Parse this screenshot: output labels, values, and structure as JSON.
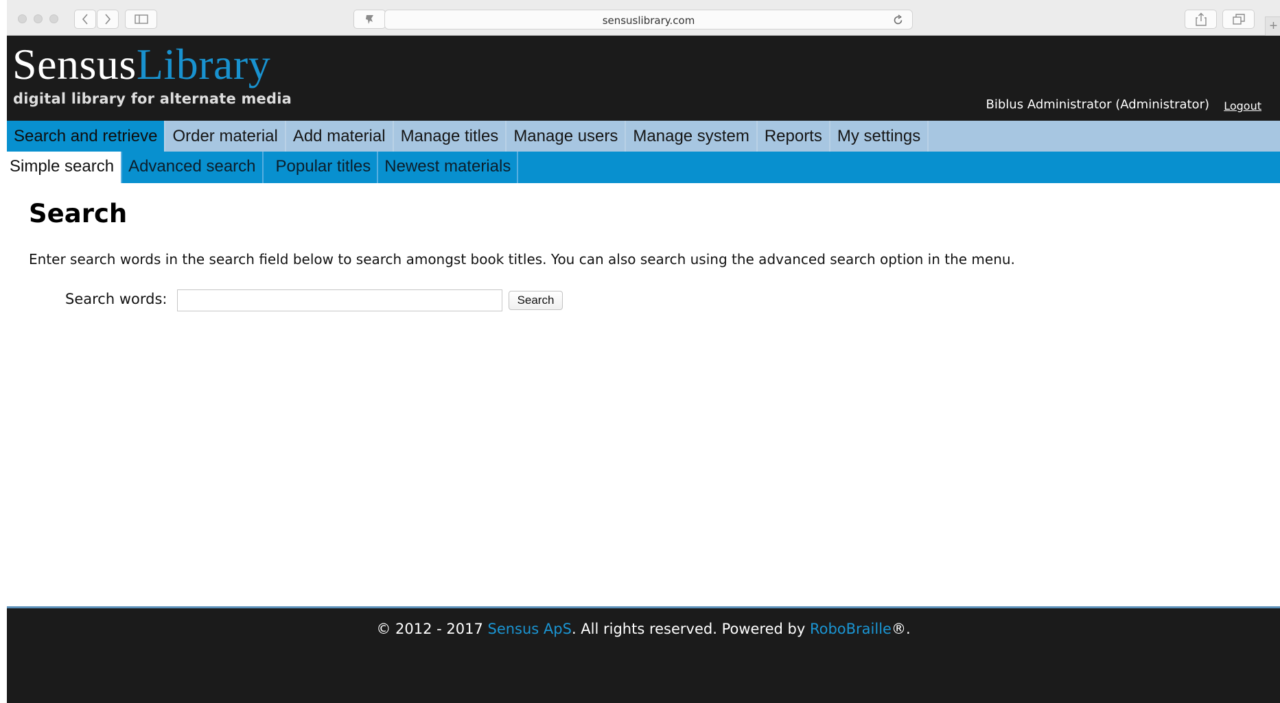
{
  "browser": {
    "url": "sensuslibrary.com"
  },
  "header": {
    "logo_part1": "Sensus",
    "logo_part2": "Library",
    "tagline": "digital library for alternate media",
    "user": "Biblus Administrator (Administrator)",
    "logout": "Logout"
  },
  "main_nav": [
    {
      "label": "Search and retrieve",
      "active": true
    },
    {
      "label": "Order material",
      "active": false
    },
    {
      "label": "Add material",
      "active": false
    },
    {
      "label": "Manage titles",
      "active": false
    },
    {
      "label": "Manage users",
      "active": false
    },
    {
      "label": "Manage system",
      "active": false
    },
    {
      "label": "Reports",
      "active": false
    },
    {
      "label": "My settings",
      "active": false
    }
  ],
  "sub_nav": [
    {
      "label": "Simple search",
      "active": true
    },
    {
      "label": "Advanced search",
      "active": false
    },
    {
      "label": "Popular titles",
      "active": false
    },
    {
      "label": "Newest materials",
      "active": false
    }
  ],
  "content": {
    "title": "Search",
    "intro": "Enter search words in the search field below to search amongst book titles. You can also search using the advanced search option in the menu.",
    "search_label": "Search words:",
    "search_value": "",
    "search_button": "Search"
  },
  "footer": {
    "prefix": "© 2012 - 2017 ",
    "company": "Sensus ApS",
    "middle": ". All rights reserved. Powered by ",
    "powered": "RoboBraille",
    "suffix": "®."
  },
  "colors": {
    "header_bg": "#1b1b1b",
    "accent_blue": "#0890cf",
    "nav_light": "#a7c6e1",
    "logo_blue": "#1992cf"
  }
}
